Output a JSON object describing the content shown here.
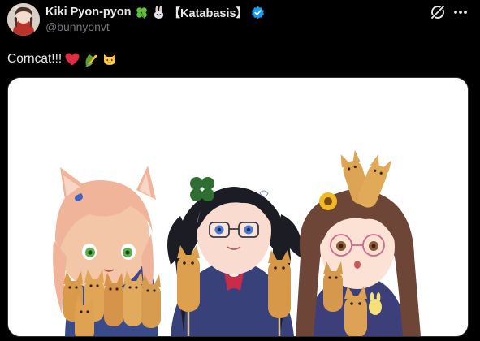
{
  "author": {
    "display_name": "Kiki Pyon-pyon",
    "name_tag": "【Katabasis】",
    "handle": "@bunnyonvt",
    "verified": true,
    "name_icons": [
      "four-leaf-clover-icon",
      "rabbit-icon"
    ]
  },
  "header_actions": {
    "grok_icon": "grok-icon",
    "more_icon": "more-icon"
  },
  "tweet": {
    "text": "Corncat!!!",
    "emojis": [
      "red-heart",
      "ear-of-corn",
      "cat-face"
    ]
  },
  "media": {
    "kind": "image",
    "background": "#ffffff"
  },
  "colors": {
    "background": "#000000",
    "primary_text": "#e7e9ea",
    "secondary_text": "#71767b",
    "verified_blue": "#1d9bf0",
    "card_border": "#2f3336"
  }
}
